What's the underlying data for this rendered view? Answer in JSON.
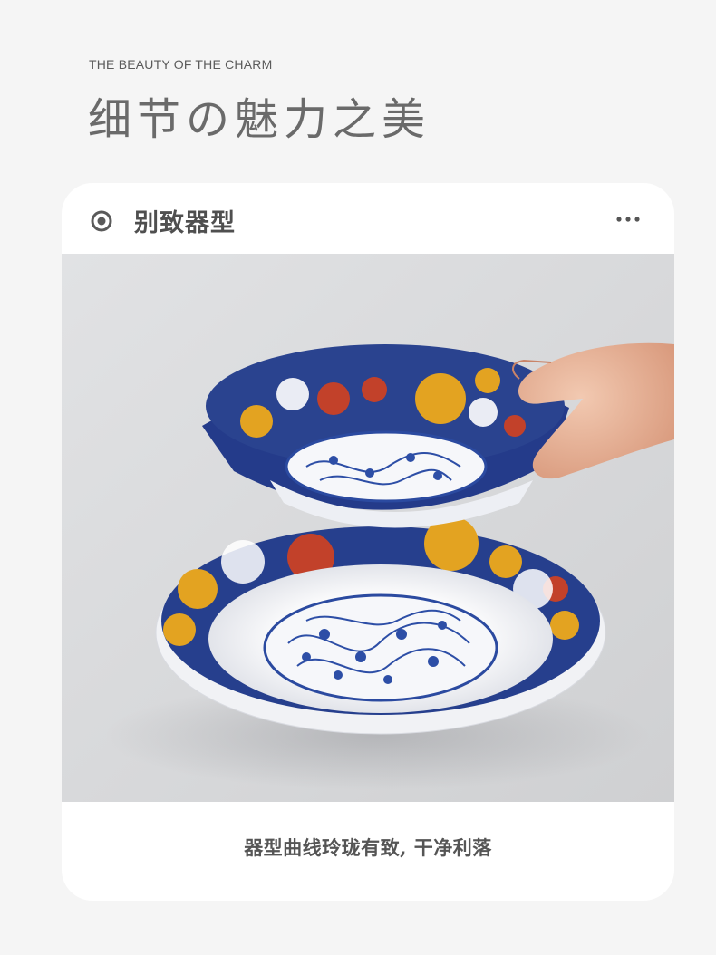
{
  "header": {
    "eyebrow": "THE BEAUTY OF THE CHARM",
    "headline": "细节の魅力之美"
  },
  "card": {
    "title": "别致器型",
    "icon": "target-icon",
    "menu_icon": "more-dots-icon",
    "caption": "器型曲线玲珑有致, 干净利落"
  },
  "colors": {
    "page_bg": "#f5f5f5",
    "card_bg": "#ffffff",
    "title_text": "#4f4f4f",
    "headline_text": "#6a6a6a",
    "photo_bg": "#d5d6d8",
    "cobalt": "#1f3d8f",
    "gold": "#e3a321",
    "red": "#c2412a"
  }
}
